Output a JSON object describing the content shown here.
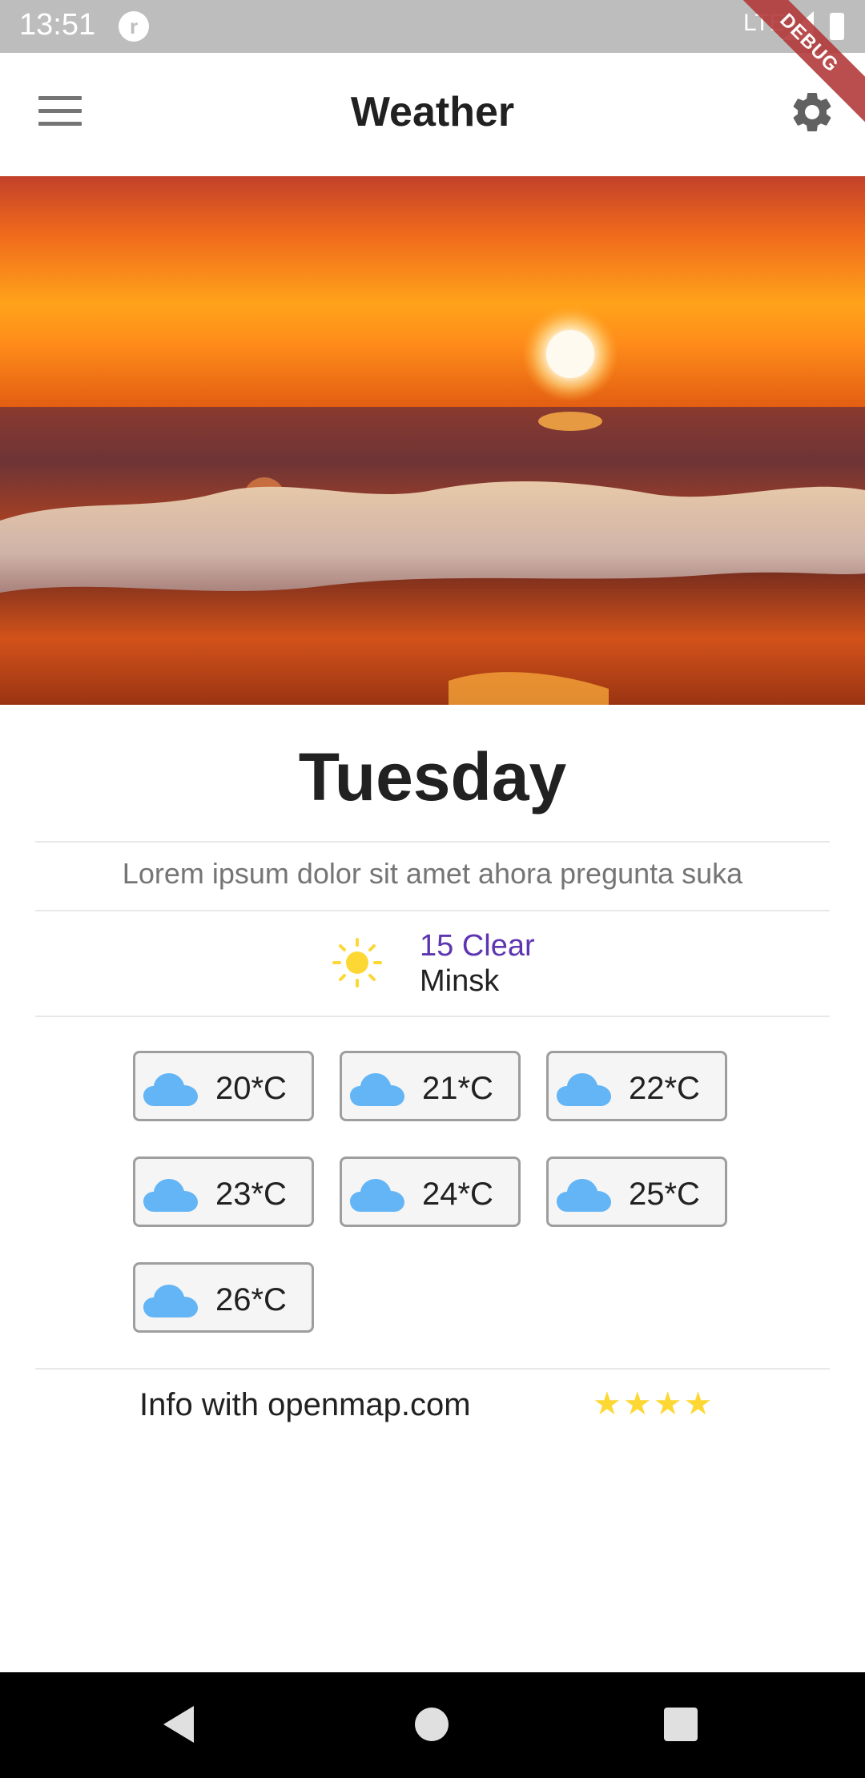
{
  "status_bar": {
    "time": "13:51",
    "network": "LTE",
    "debug_label": "DEBUG"
  },
  "app_bar": {
    "title": "Weather",
    "menu_icon": "menu-icon",
    "settings_icon": "gear-icon"
  },
  "hero_image": {
    "subject": "sunset over ocean wave"
  },
  "main": {
    "day": "Tuesday",
    "description": "Lorem ipsum dolor sit amet ahora pregunta suka",
    "current": {
      "icon": "sun-icon",
      "condition": "15 Clear",
      "city": "Minsk"
    },
    "forecast": [
      {
        "label": "20*C",
        "icon": "cloud-icon"
      },
      {
        "label": "21*C",
        "icon": "cloud-icon"
      },
      {
        "label": "22*C",
        "icon": "cloud-icon"
      },
      {
        "label": "23*C",
        "icon": "cloud-icon"
      },
      {
        "label": "24*C",
        "icon": "cloud-icon"
      },
      {
        "label": "25*C",
        "icon": "cloud-icon"
      },
      {
        "label": "26*C",
        "icon": "cloud-icon"
      }
    ],
    "footer": {
      "info": "Info with openmap.com",
      "rating": 4,
      "stars": "★★★★"
    }
  },
  "colors": {
    "accent": "#5e35b1",
    "cloud": "#64b5f6",
    "sun": "#fdd835",
    "star": "#fdd835"
  }
}
